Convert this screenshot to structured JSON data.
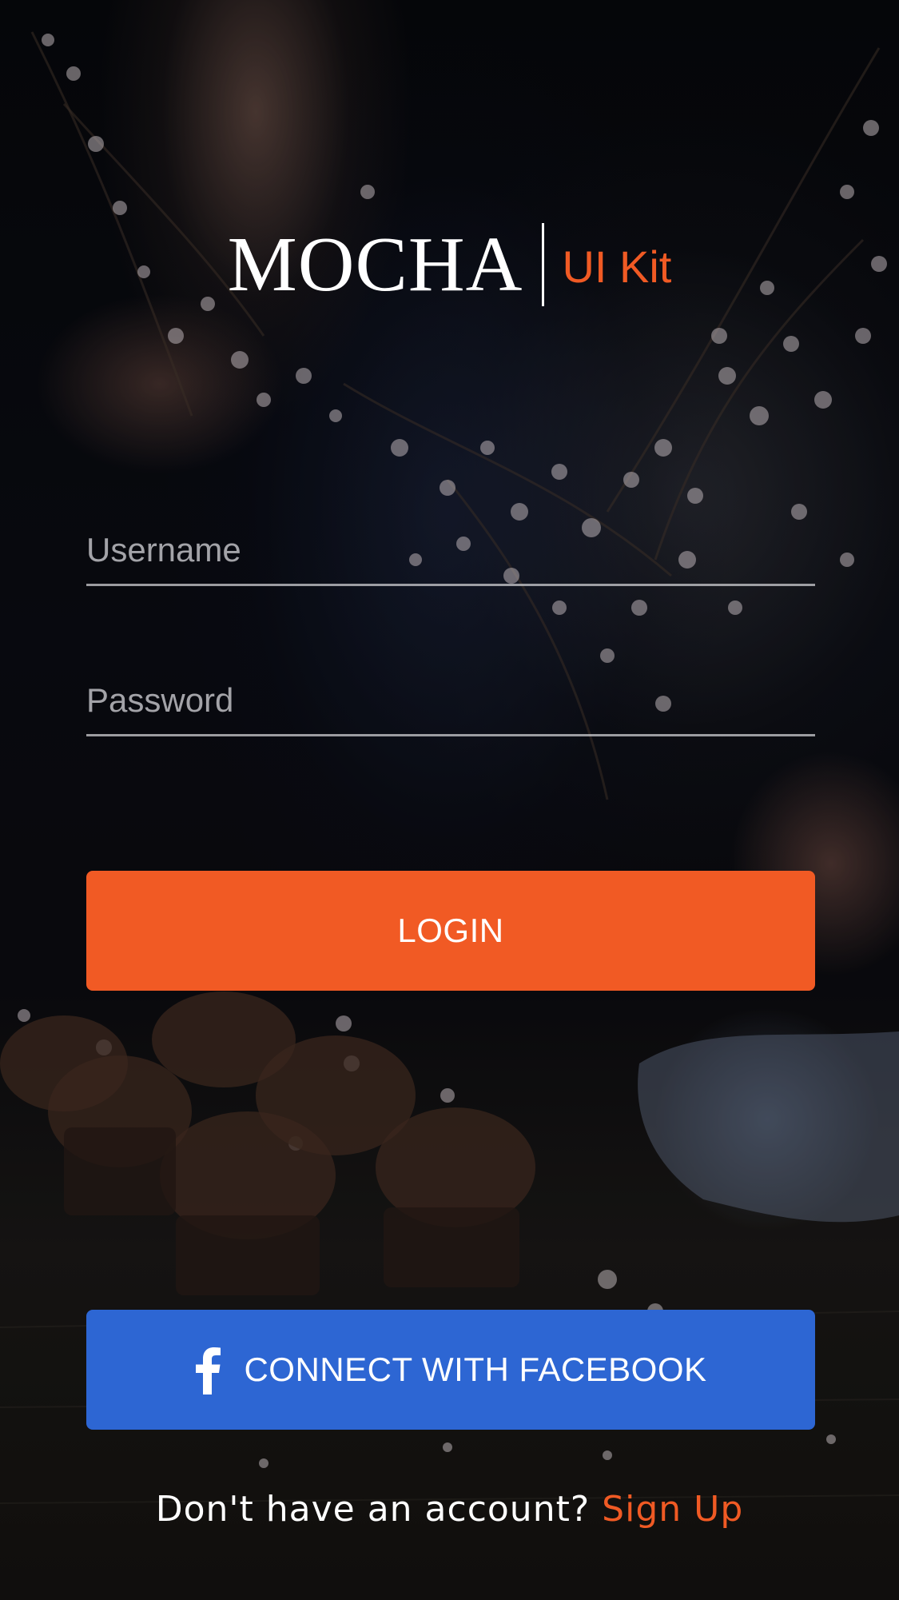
{
  "logo": {
    "main_text": "MOCHA",
    "sub_text": "UI Kit"
  },
  "form": {
    "username": {
      "placeholder": "Username",
      "value": ""
    },
    "password": {
      "placeholder": "Password",
      "value": ""
    }
  },
  "buttons": {
    "login_label": "LOGIN",
    "facebook_label": "CONNECT WITH FACEBOOK",
    "facebook_icon": "facebook-f-icon"
  },
  "signup": {
    "prompt": "Don't have an account? ",
    "link_label": "Sign Up"
  },
  "colors": {
    "accent": "#f15a24",
    "facebook": "#2d66d3",
    "text": "#ffffff"
  }
}
